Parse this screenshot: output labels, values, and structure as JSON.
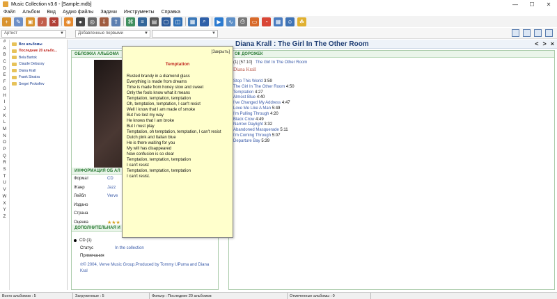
{
  "window": {
    "title": "Music Collection v3.6 - [Sample.mdb]",
    "controls": [
      "—",
      "☐",
      "✕"
    ]
  },
  "menu": [
    "Файл",
    "Альбом",
    "Вид",
    "Аудио файлы",
    "Задачи",
    "Инструменты",
    "Справка"
  ],
  "toolbar": {
    "icons": [
      {
        "name": "add-album-icon",
        "color": "#d9932f",
        "glyph": "+"
      },
      {
        "name": "edit-album-icon",
        "color": "#6d8fc7",
        "glyph": "✎"
      },
      {
        "name": "album-folder-icon",
        "color": "#d9932f",
        "glyph": "▣"
      },
      {
        "name": "add-tracks-icon",
        "color": "#c25d4a",
        "glyph": "♪"
      },
      {
        "name": "delete-icon",
        "color": "#b03e35",
        "glyph": "✕"
      },
      {
        "name": "cd-player-icon",
        "color": "#e58a2e",
        "glyph": "◉"
      },
      {
        "name": "disc-icon",
        "color": "#444444",
        "glyph": "●"
      },
      {
        "name": "scan-disc-icon",
        "color": "#6a6a6a",
        "glyph": "◎"
      },
      {
        "name": "import-icon",
        "color": "#a05c40",
        "glyph": "⇩"
      },
      {
        "name": "export-icon",
        "color": "#5d7fb0",
        "glyph": "⇧"
      },
      {
        "name": "tag-icon",
        "color": "#3f8f5e",
        "glyph": "⌘"
      },
      {
        "name": "list-icon",
        "color": "#336699",
        "glyph": "≡"
      },
      {
        "name": "report-icon",
        "color": "#555555",
        "glyph": "▤"
      },
      {
        "name": "window-icon",
        "color": "#2d5b9a",
        "glyph": "▢"
      },
      {
        "name": "browser-icon",
        "color": "#2f6fb5",
        "glyph": "◫"
      },
      {
        "name": "image-icon",
        "color": "#3b78b8",
        "glyph": "▦"
      },
      {
        "name": "search-icon",
        "color": "#2e5fa8",
        "glyph": "⌕"
      },
      {
        "name": "play-icon",
        "color": "#2c7bd0",
        "glyph": "▶"
      },
      {
        "name": "statistics-icon",
        "color": "#5d8fc7",
        "glyph": "∿"
      },
      {
        "name": "print-icon",
        "color": "#777777",
        "glyph": "⎙"
      },
      {
        "name": "card-icon",
        "color": "#d86a2b",
        "glyph": "▭"
      },
      {
        "name": "chart-icon",
        "color": "#d94636",
        "glyph": "◔"
      },
      {
        "name": "gallery-icon",
        "color": "#4a7cc0",
        "glyph": "▦"
      },
      {
        "name": "user-icon",
        "color": "#3f73b5",
        "glyph": "☺"
      },
      {
        "name": "duck-icon",
        "color": "#e0b030",
        "glyph": "☘"
      }
    ]
  },
  "filters": {
    "field": "Артист",
    "sort": "Добавленные первыми",
    "search_placeholder": ""
  },
  "alphabet": [
    "#",
    "A",
    "B",
    "C",
    "D",
    "E",
    "F",
    "G",
    "H",
    "I",
    "J",
    "K",
    "L",
    "M",
    "N",
    "O",
    "P",
    "Q",
    "R",
    "S",
    "T",
    "U",
    "V",
    "W",
    "X",
    "Y",
    "Z"
  ],
  "tree": [
    {
      "label": "Все альбомы",
      "style": "b"
    },
    {
      "label": "Последние 20 альбо...",
      "style": "r"
    },
    {
      "label": "Bela Bartok",
      "style": ""
    },
    {
      "label": "Claude Debussy",
      "style": ""
    },
    {
      "label": "Diana Krall",
      "style": ""
    },
    {
      "label": "Frank Sinatra",
      "style": ""
    },
    {
      "label": "Sergei Prokofiev",
      "style": ""
    }
  ],
  "album": {
    "heading": "Diana Krall : The Girl In The Other Room",
    "prev": "<",
    "next": ">",
    "close": "×",
    "cover_header": "ОБЛОЖКА АЛЬБОМА",
    "cover_text": "DI",
    "info_header": "ИНФОРМАЦИЯ ОБ АЛ",
    "props": [
      {
        "k": "Формат",
        "v": "CD"
      },
      {
        "k": "Жанр",
        "v": "Jazz"
      },
      {
        "k": "Лейбл",
        "v": "Verve"
      },
      {
        "k": "Издано",
        "v": ""
      },
      {
        "k": "Страна",
        "v": ""
      }
    ],
    "rating_label": "Оценка",
    "rating": 3,
    "rating_stars": "★★★",
    "extra_header": "ДОПОЛНИТЕЛЬНАЯ И",
    "cd": "CD (1)",
    "status_label": "Статус",
    "status_value": "In the collection",
    "notes_label": "Примечания",
    "notes": "℗© 2004, Verve Music Group.Produced by Tommy UPuma and Diana Kral"
  },
  "tracklist": {
    "header": "ОК ДОРОЖЕК",
    "disc_line": "(1) [57:10]",
    "disc_title": "The Girl In The Other Room",
    "artist": "Diana Krall",
    "tracks": [
      {
        "name": "Stop This World",
        "time": "3:59"
      },
      {
        "name": "The Girl In The Other Room",
        "time": "4:50"
      },
      {
        "name": "Temptation",
        "time": "4:27"
      },
      {
        "name": "Almost Blue",
        "time": "4:40"
      },
      {
        "name": "I've Changed My Address",
        "time": "4:47"
      },
      {
        "name": "Love Me Like A Man",
        "time": "5:49"
      },
      {
        "name": "I'm Pulling Through",
        "time": "4:20"
      },
      {
        "name": "Black Crow",
        "time": "4:49"
      },
      {
        "name": "Narrow Daylight",
        "time": "3:32"
      },
      {
        "name": "Abandoned Masquerade",
        "time": "5:11"
      },
      {
        "name": "I'm Coming Through",
        "time": "5:07"
      },
      {
        "name": "Departure Bay",
        "time": "5:39"
      }
    ]
  },
  "lyrics": {
    "close": "[Закрыть]",
    "title": "Temptation",
    "text": "Rusted brandy in a diamond glass\nEverything is made from dreams\nTime is made from honey slow and sweet\nOnly the fools know what it means\nTemptation, temptation, temptation\nOh, temptation, temptation, I can't resist\nWell I know that I am made of smoke\nBut I've lost my way\nHe knows that I am broke\nBut I must play\nTemptation, oh temptation, temptation, I can't resist\nDutch pink and Italian blue\nHe is there waiting for you\nMy will has disappeared\nNow confusion is so clear\nTemptation, temptation, temptation\nI can't resist\nTemptation, temptation, temptation\nI can't resist."
  },
  "status": {
    "total": "Всего альбомов : 5",
    "loaded": "Загруженные : 5",
    "filter": "Фильтр : Последние 20 альбомов",
    "marked": "Отмеченные альбомы : 0"
  }
}
